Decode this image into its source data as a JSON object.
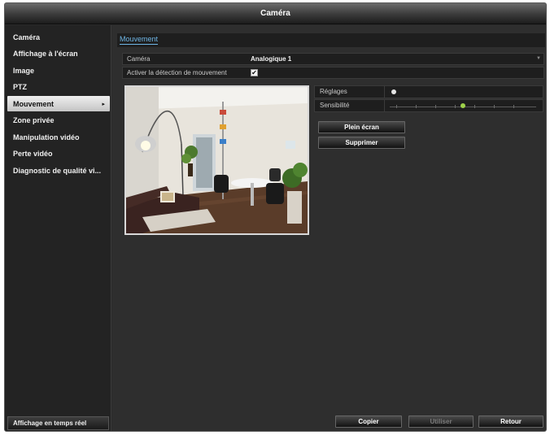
{
  "window": {
    "title": "Caméra"
  },
  "sidebar": {
    "items": [
      {
        "label": "Caméra"
      },
      {
        "label": "Affichage à l'écran"
      },
      {
        "label": "Image"
      },
      {
        "label": "PTZ"
      },
      {
        "label": "Mouvement",
        "arrow": "▸"
      },
      {
        "label": "Zone privée"
      },
      {
        "label": "Manipulation vidéo"
      },
      {
        "label": "Perte vidéo"
      },
      {
        "label": "Diagnostic de qualité vi..."
      }
    ],
    "live_view_label": "Affichage en temps réel"
  },
  "main": {
    "tab_label": "Mouvement",
    "camera_label": "Caméra",
    "camera_value": "Analogique 1",
    "camera_dropdown_icon": "chevron-down-icon",
    "enable_label": "Activer la détection de mouvement",
    "enable_checked": "✔",
    "settings_label": "Réglages",
    "sensitivity_label": "Sensibilité",
    "sensitivity_level": 0.5,
    "fullscreen_button": "Plein écran",
    "delete_button": "Supprimer"
  },
  "footer": {
    "copy": "Copier",
    "apply": "Utiliser",
    "back": "Retour"
  },
  "colors": {
    "accent_tab": "#6fb6e6",
    "slider_thumb": "#9fd24a"
  }
}
